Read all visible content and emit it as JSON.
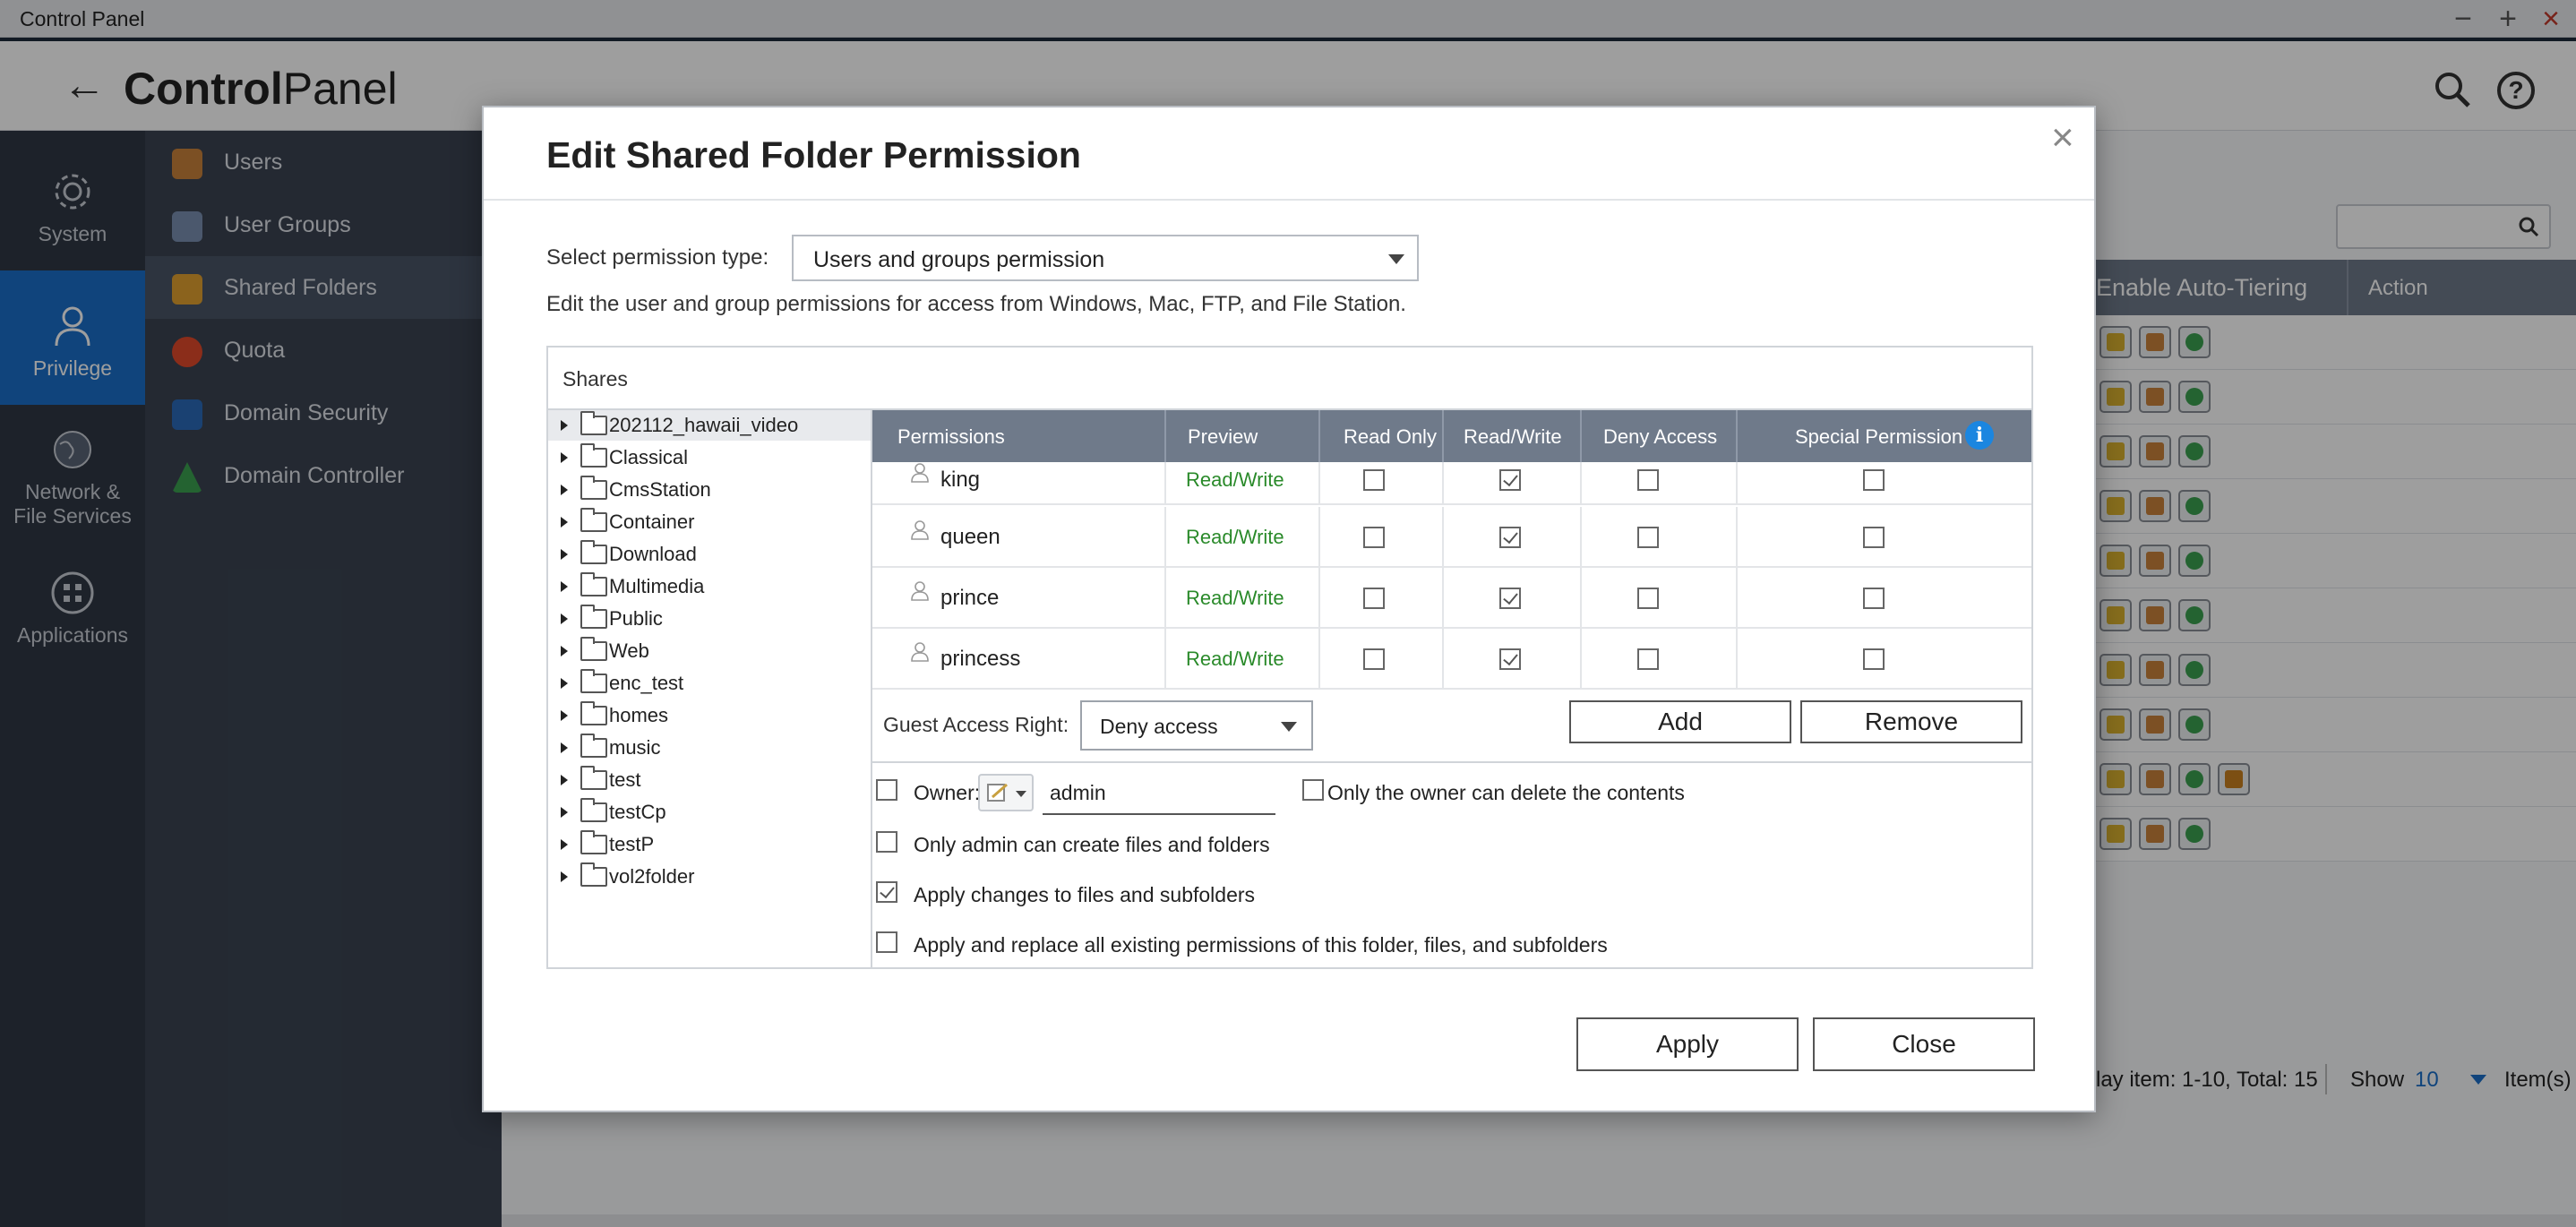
{
  "window": {
    "title": "Control Panel"
  },
  "header": {
    "title_bold": "Control",
    "title_light": "Panel"
  },
  "left_nav": [
    {
      "label": "System",
      "icon": "gear-icon"
    },
    {
      "label": "Privilege",
      "icon": "user-icon",
      "active": true
    },
    {
      "label_line1": "Network &",
      "label_line2": "File Services",
      "icon": "globe-icon"
    },
    {
      "label": "Applications",
      "icon": "grid-icon"
    }
  ],
  "sub_nav": [
    {
      "label": "Users",
      "icon": "users-icon",
      "color": "#c8813a"
    },
    {
      "label": "User Groups",
      "icon": "user-groups-icon",
      "color": "#7a8fb0"
    },
    {
      "label": "Shared Folders",
      "icon": "shared-folder-icon",
      "color": "#e0a030",
      "active": true
    },
    {
      "label": "Quota",
      "icon": "quota-icon",
      "color": "#e04a2a"
    },
    {
      "label": "Domain Security",
      "icon": "domain-security-icon",
      "color": "#2a6ab8"
    },
    {
      "label": "Domain Controller",
      "icon": "domain-controller-icon",
      "color": "#3aa050"
    }
  ],
  "bg_table": {
    "col_auto_tiering": "Enable Auto-Tiering",
    "col_action": "Action",
    "footer_display": "lay item: 1-10, Total: 15",
    "footer_show": "Show",
    "footer_count": "10",
    "footer_items": "Item(s)"
  },
  "dialog": {
    "title": "Edit Shared Folder Permission",
    "permission_type_label": "Select permission type:",
    "permission_type_value": "Users and groups permission",
    "description": "Edit the user and group permissions for access from Windows, Mac, FTP, and File Station.",
    "shares_label": "Shares",
    "shares": [
      "202112_hawaii_video",
      "Classical",
      "CmsStation",
      "Container",
      "Download",
      "Multimedia",
      "Public",
      "Web",
      "enc_test",
      "homes",
      "music",
      "test",
      "testCp",
      "testP",
      "vol2folder"
    ],
    "columns": {
      "permissions": "Permissions",
      "preview": "Preview",
      "read_only": "Read Only",
      "read_write": "Read/Write",
      "deny_access": "Deny Access",
      "special_permission": "Special Permission"
    },
    "rows": [
      {
        "name": "king",
        "preview": "Read/Write",
        "read_only": false,
        "read_write": true,
        "deny": false,
        "special": false
      },
      {
        "name": "queen",
        "preview": "Read/Write",
        "read_only": false,
        "read_write": true,
        "deny": false,
        "special": false
      },
      {
        "name": "prince",
        "preview": "Read/Write",
        "read_only": false,
        "read_write": true,
        "deny": false,
        "special": false
      },
      {
        "name": "princess",
        "preview": "Read/Write",
        "read_only": false,
        "read_write": true,
        "deny": false,
        "special": false
      }
    ],
    "guest_label": "Guest Access Right:",
    "guest_value": "Deny access",
    "add_label": "Add",
    "remove_label": "Remove",
    "owner_label": "Owner:",
    "owner_value": "admin",
    "owner_checked": false,
    "only_owner_delete": "Only the owner can delete the contents",
    "only_owner_delete_checked": false,
    "only_admin_create": "Only admin can create files and folders",
    "only_admin_create_checked": false,
    "apply_changes": "Apply changes to files and subfolders",
    "apply_changes_checked": true,
    "apply_replace": "Apply and replace all existing permissions of this folder, files, and subfolders",
    "apply_replace_checked": false,
    "apply_label": "Apply",
    "close_label": "Close"
  }
}
